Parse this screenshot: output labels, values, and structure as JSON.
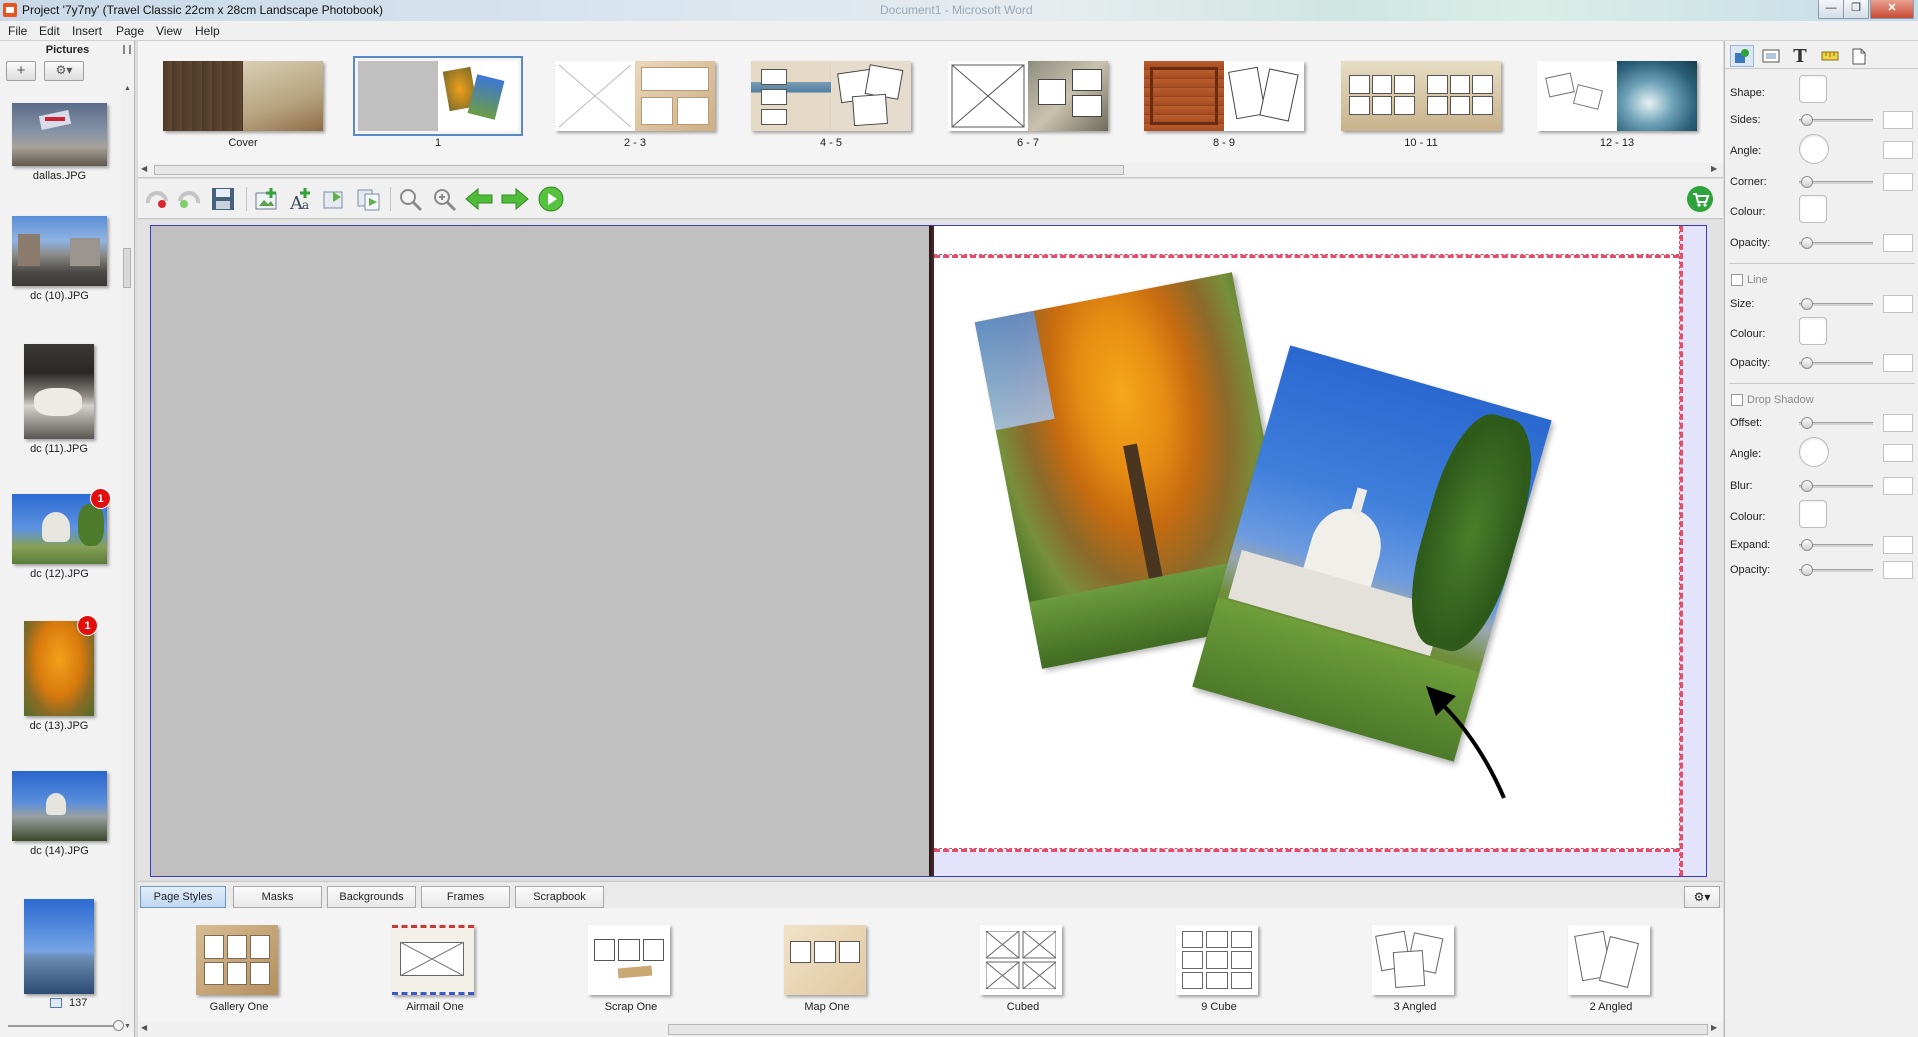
{
  "window": {
    "title": "Project '7y7ny' (Travel Classic 22cm x 28cm Landscape Photobook)",
    "background_title": "Document1 - Microsoft Word",
    "minimize_label": "—",
    "maximize_label": "❐",
    "close_label": "✕"
  },
  "menu": [
    "File",
    "Edit",
    "Insert",
    "Page",
    "View",
    "Help"
  ],
  "pictures": {
    "header": "Pictures",
    "add_label": "+",
    "settings_label": "⚙▾",
    "items": [
      {
        "name": "dallas.JPG"
      },
      {
        "name": "dc (10).JPG"
      },
      {
        "name": "dc (11).JPG"
      },
      {
        "name": "dc (12).JPG",
        "badge": "1"
      },
      {
        "name": "dc (13).JPG",
        "badge": "1"
      },
      {
        "name": "dc (14).JPG"
      },
      {
        "name": ""
      }
    ],
    "count": "137"
  },
  "spreads": [
    "Cover",
    "1",
    "2 - 3",
    "4 - 5",
    "6 - 7",
    "8 - 9",
    "10 - 11",
    "12 - 13"
  ],
  "tabs": [
    "Page Styles",
    "Masks",
    "Backgrounds",
    "Frames",
    "Scrapbook"
  ],
  "styles": [
    "Gallery One",
    "Airmail One",
    "Scrap One",
    "Map One",
    "Cubed",
    "9 Cube",
    "3 Angled",
    "2 Angled"
  ],
  "properties": {
    "shape": "Shape:",
    "sides": "Sides:",
    "angle": "Angle:",
    "corner": "Corner:",
    "colour": "Colour:",
    "opacity": "Opacity:",
    "line": "Line",
    "size": "Size:",
    "line_colour": "Colour:",
    "line_opacity": "Opacity:",
    "drop_shadow": "Drop Shadow",
    "offset": "Offset:",
    "ds_angle": "Angle:",
    "blur": "Blur:",
    "ds_colour": "Colour:",
    "expand": "Expand:",
    "ds_opacity": "Opacity:"
  },
  "colors": {
    "accent": "#5a89c8",
    "badge": "#e20d0d",
    "bleed_line": "#e34d6a",
    "page_border": "#3a3acd"
  }
}
